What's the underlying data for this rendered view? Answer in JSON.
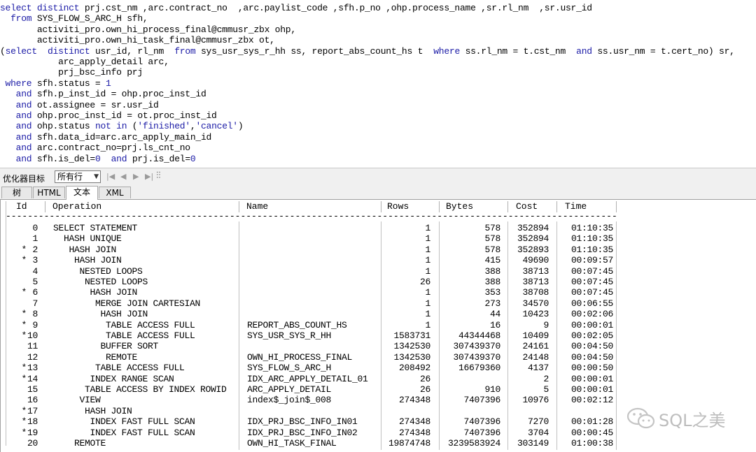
{
  "sql_editor": {
    "lines": [
      [
        [
          "k",
          "select distinct "
        ],
        [
          "t",
          "prj.cst_nm ,arc.contract_no  ,arc.paylist_code ,sfh.p_no ,ohp.process_name ,sr.rl_nm  ,sr.usr_id"
        ]
      ],
      [
        [
          "k",
          "  from "
        ],
        [
          "t",
          "SYS_FLOW_S_ARC_H sfh,"
        ]
      ],
      [
        [
          "t",
          "       activiti_pro.own_hi_process_final@cmmusr_zbx ohp,"
        ]
      ],
      [
        [
          "t",
          "       activiti_pro.own_hi_task_final@cmmusr_zbx ot,"
        ]
      ],
      [
        [
          "t",
          "("
        ],
        [
          "k",
          "select  distinct "
        ],
        [
          "t",
          "usr_id, rl_nm  "
        ],
        [
          "k",
          "from "
        ],
        [
          "t",
          "sys_usr_sys_r_hh ss, report_abs_count_hs t  "
        ],
        [
          "k",
          "where "
        ],
        [
          "t",
          "ss.rl_nm = t.cst_nm  "
        ],
        [
          "k",
          "and "
        ],
        [
          "t",
          "ss.usr_nm = t.cert_no) sr,"
        ]
      ],
      [
        [
          "t",
          "           arc_apply_detail arc,"
        ]
      ],
      [
        [
          "t",
          "           prj_bsc_info prj"
        ]
      ],
      [
        [
          "k",
          " where "
        ],
        [
          "t",
          "sfh.status = "
        ],
        [
          "s",
          "1"
        ]
      ],
      [
        [
          "k",
          "   and "
        ],
        [
          "t",
          "sfh.p_inst_id = ohp.proc_inst_id"
        ]
      ],
      [
        [
          "k",
          "   and "
        ],
        [
          "t",
          "ot.assignee = sr.usr_id"
        ]
      ],
      [
        [
          "k",
          "   and "
        ],
        [
          "t",
          "ohp.proc_inst_id = ot.proc_inst_id"
        ]
      ],
      [
        [
          "k",
          "   and "
        ],
        [
          "t",
          "ohp.status "
        ],
        [
          "k",
          "not in "
        ],
        [
          "t",
          "("
        ],
        [
          "s",
          "'finished'"
        ],
        [
          "t",
          ","
        ],
        [
          "s",
          "'cancel'"
        ],
        [
          "t",
          ")"
        ]
      ],
      [
        [
          "k",
          "   and "
        ],
        [
          "t",
          "sfh.data_id=arc.arc_apply_main_id"
        ]
      ],
      [
        [
          "k",
          "   and "
        ],
        [
          "t",
          "arc.contract_no=prj.ls_cnt_no"
        ]
      ],
      [
        [
          "k",
          "   and "
        ],
        [
          "t",
          "sfh.is_del="
        ],
        [
          "s",
          "0"
        ],
        [
          "k",
          "  and "
        ],
        [
          "t",
          "prj.is_del="
        ],
        [
          "s",
          "0"
        ]
      ]
    ]
  },
  "toolbar": {
    "label": "优化器目标",
    "goal_value": "所有行",
    "icons": [
      "first-icon",
      "prev-icon",
      "next-icon",
      "last-icon",
      "tune-icon"
    ]
  },
  "tabs": [
    {
      "label": "树",
      "active": false
    },
    {
      "label": "HTML",
      "active": false
    },
    {
      "label": "文本",
      "active": true
    },
    {
      "label": "XML",
      "active": false
    }
  ],
  "plan": {
    "headers": [
      "Id",
      "Operation",
      "Name",
      "Rows",
      "Bytes",
      "Cost",
      "Time"
    ],
    "rule": "------------------------------------------------------------------------------------------------------------------------------------------",
    "rows": [
      {
        "star": "",
        "id": "0",
        "op": "SELECT STATEMENT",
        "name": "",
        "rows": "1",
        "bytes": "578",
        "cost": "352894",
        "time": "01:10:35"
      },
      {
        "star": "",
        "id": "1",
        "op": "  HASH UNIQUE",
        "name": "",
        "rows": "1",
        "bytes": "578",
        "cost": "352894",
        "time": "01:10:35"
      },
      {
        "star": "*",
        "id": "2",
        "op": "   HASH JOIN",
        "name": "",
        "rows": "1",
        "bytes": "578",
        "cost": "352893",
        "time": "01:10:35"
      },
      {
        "star": "*",
        "id": "3",
        "op": "    HASH JOIN",
        "name": "",
        "rows": "1",
        "bytes": "415",
        "cost": "49690",
        "time": "00:09:57"
      },
      {
        "star": "",
        "id": "4",
        "op": "     NESTED LOOPS",
        "name": "",
        "rows": "1",
        "bytes": "388",
        "cost": "38713",
        "time": "00:07:45"
      },
      {
        "star": "",
        "id": "5",
        "op": "      NESTED LOOPS",
        "name": "",
        "rows": "26",
        "bytes": "388",
        "cost": "38713",
        "time": "00:07:45"
      },
      {
        "star": "*",
        "id": "6",
        "op": "       HASH JOIN",
        "name": "",
        "rows": "1",
        "bytes": "353",
        "cost": "38708",
        "time": "00:07:45"
      },
      {
        "star": "",
        "id": "7",
        "op": "        MERGE JOIN CARTESIAN",
        "name": "",
        "rows": "1",
        "bytes": "273",
        "cost": "34570",
        "time": "00:06:55"
      },
      {
        "star": "*",
        "id": "8",
        "op": "         HASH JOIN",
        "name": "",
        "rows": "1",
        "bytes": "44",
        "cost": "10423",
        "time": "00:02:06"
      },
      {
        "star": "*",
        "id": "9",
        "op": "          TABLE ACCESS FULL",
        "name": "REPORT_ABS_COUNT_HS",
        "rows": "1",
        "bytes": "16",
        "cost": "9",
        "time": "00:00:01"
      },
      {
        "star": "*",
        "id": "10",
        "op": "          TABLE ACCESS FULL",
        "name": "SYS_USR_SYS_R_HH",
        "rows": "1583731",
        "bytes": "44344468",
        "cost": "10409",
        "time": "00:02:05"
      },
      {
        "star": "",
        "id": "11",
        "op": "         BUFFER SORT",
        "name": "",
        "rows": "1342530",
        "bytes": "307439370",
        "cost": "24161",
        "time": "00:04:50"
      },
      {
        "star": "",
        "id": "12",
        "op": "          REMOTE",
        "name": "OWN_HI_PROCESS_FINAL",
        "rows": "1342530",
        "bytes": "307439370",
        "cost": "24148",
        "time": "00:04:50"
      },
      {
        "star": "*",
        "id": "13",
        "op": "        TABLE ACCESS FULL",
        "name": "SYS_FLOW_S_ARC_H",
        "rows": "208492",
        "bytes": "16679360",
        "cost": "4137",
        "time": "00:00:50"
      },
      {
        "star": "*",
        "id": "14",
        "op": "       INDEX RANGE SCAN",
        "name": "IDX_ARC_APPLY_DETAIL_01",
        "rows": "26",
        "bytes": "",
        "cost": "2",
        "time": "00:00:01"
      },
      {
        "star": "",
        "id": "15",
        "op": "      TABLE ACCESS BY INDEX ROWID",
        "name": "ARC_APPLY_DETAIL",
        "rows": "26",
        "bytes": "910",
        "cost": "5",
        "time": "00:00:01"
      },
      {
        "star": "",
        "id": "16",
        "op": "     VIEW",
        "name": "index$_join$_008",
        "rows": "274348",
        "bytes": "7407396",
        "cost": "10976",
        "time": "00:02:12"
      },
      {
        "star": "*",
        "id": "17",
        "op": "      HASH JOIN",
        "name": "",
        "rows": "",
        "bytes": "",
        "cost": "",
        "time": ""
      },
      {
        "star": "*",
        "id": "18",
        "op": "       INDEX FAST FULL SCAN",
        "name": "IDX_PRJ_BSC_INFO_IN01",
        "rows": "274348",
        "bytes": "7407396",
        "cost": "7270",
        "time": "00:01:28"
      },
      {
        "star": "*",
        "id": "19",
        "op": "       INDEX FAST FULL SCAN",
        "name": "IDX_PRJ_BSC_INFO_IN02",
        "rows": "274348",
        "bytes": "7407396",
        "cost": "3704",
        "time": "00:00:45"
      },
      {
        "star": "",
        "id": "20",
        "op": "    REMOTE",
        "name": "OWN_HI_TASK_FINAL",
        "rows": "19874748",
        "bytes": "3239583924",
        "cost": "303149",
        "time": "01:00:38"
      }
    ]
  },
  "watermark": {
    "text": "SQL之美",
    "icon": "wechat-icon"
  }
}
